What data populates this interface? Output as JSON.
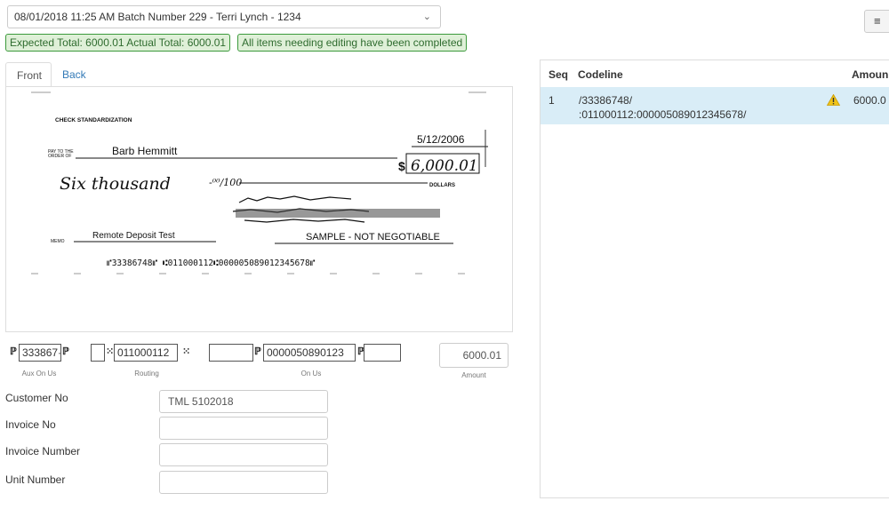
{
  "batch": {
    "selected": "08/01/2018 11:25 AM Batch Number 229 - Terri Lynch - 1234"
  },
  "badges": {
    "totals": "Expected Total: 6000.01 Actual Total: 6000.01",
    "status": "All items needing editing have been completed"
  },
  "tabs": [
    {
      "label": "Front"
    },
    {
      "label": "Back"
    }
  ],
  "check": {
    "header": "CHECK STANDARDIZATION",
    "date": "5/12/2006",
    "pay_to_label_1": "PAY TO THE",
    "pay_to_label_2": "ORDER OF",
    "payee": "Barb Hemmitt",
    "amount_numeric": "6,000.01",
    "amount_words": "Six thousand",
    "fraction": "-⁰⁰/100",
    "dollars": "DOLLARS",
    "memo_label": "MEMO",
    "memo": "Remote Deposit Test",
    "sample": "SAMPLE - NOT NEGOTIABLE",
    "micr": "⑈33386748⑈ ⑆011000112⑆000005089012345678⑈"
  },
  "codeline_fields": {
    "aux_on_us": "333867·",
    "routing": "011000112",
    "blank": "",
    "on_us": "0000050890123",
    "trailing": "",
    "amount": "6000.01",
    "captions": {
      "aux_on_us": "Aux On Us",
      "routing": "Routing",
      "on_us": "On Us",
      "amount": "Amount"
    }
  },
  "form": {
    "customer_no": {
      "label": "Customer No",
      "value": "TML 5102018"
    },
    "invoice_no": {
      "label": "Invoice No",
      "value": ""
    },
    "invoice_number": {
      "label": "Invoice Number",
      "value": ""
    },
    "unit_number": {
      "label": "Unit Number",
      "value": ""
    }
  },
  "table": {
    "headers": [
      "Seq",
      "Codeline",
      "Amoun"
    ],
    "rows": [
      {
        "seq": "1",
        "codeline_1": "/33386748/",
        "codeline_2": ":011000112:000005089012345678/",
        "amount": "6000.0"
      }
    ]
  },
  "colors": {
    "success_bg": "#dff0d8",
    "success_border": "#3c9a3c",
    "selected_row": "#d9edf7",
    "link": "#337ab7",
    "warning": "#f0c419"
  }
}
